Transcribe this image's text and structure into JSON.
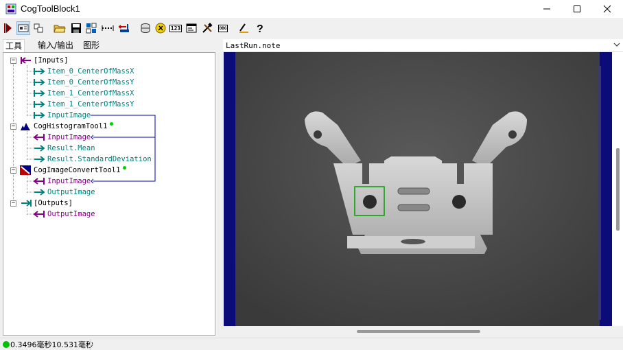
{
  "window": {
    "title": "CogToolBlock1",
    "controls": [
      "minimize",
      "maximize",
      "close"
    ]
  },
  "toolbar": {
    "buttons": [
      {
        "name": "run-icon"
      },
      {
        "name": "show-tree-icon"
      },
      {
        "name": "show-properties-icon"
      },
      {
        "name": "open-icon"
      },
      {
        "name": "save-icon"
      },
      {
        "name": "tool-icon"
      },
      {
        "name": "link-icon"
      },
      {
        "name": "terminal-icon"
      },
      {
        "name": "database-icon"
      },
      {
        "name": "script-icon"
      },
      {
        "name": "number-icon"
      },
      {
        "name": "display-icon"
      },
      {
        "name": "tools-icon"
      },
      {
        "name": "dbg-icon"
      },
      {
        "name": "edit-icon"
      },
      {
        "name": "help-icon"
      }
    ],
    "labels": {
      "number": "123",
      "dbg": "DBG"
    }
  },
  "tabs": [
    {
      "label": "工具",
      "active": true
    },
    {
      "label": "输入/输出",
      "active": false
    },
    {
      "label": "图形",
      "active": false
    }
  ],
  "tree": {
    "inputs_label": "[Inputs]",
    "inputs": [
      "Item_0_CenterOfMassX",
      "Item_0_CenterOfMassY",
      "Item_1_CenterOfMassX",
      "Item_1_CenterOfMassY",
      "InputImage"
    ],
    "histogram_tool": "CogHistogramTool1",
    "histogram_items": [
      "InputImage",
      "Result.Mean",
      "Result.StandardDeviation"
    ],
    "convert_tool": "CogImageConvertTool1",
    "convert_items": [
      "InputImage",
      "OutputImage"
    ],
    "outputs_label": "[Outputs]",
    "outputs": [
      "OutputImage"
    ]
  },
  "display": {
    "selected_record": "LastRun.note"
  },
  "status": {
    "time1": "0.3496毫秒",
    "time2": "10.531毫秒",
    "indicator_color": "#00c000"
  },
  "colors": {
    "teal": "#008080",
    "purple": "#800080",
    "link_blue": "#0000a0",
    "image_border": "#0b0b7a"
  }
}
